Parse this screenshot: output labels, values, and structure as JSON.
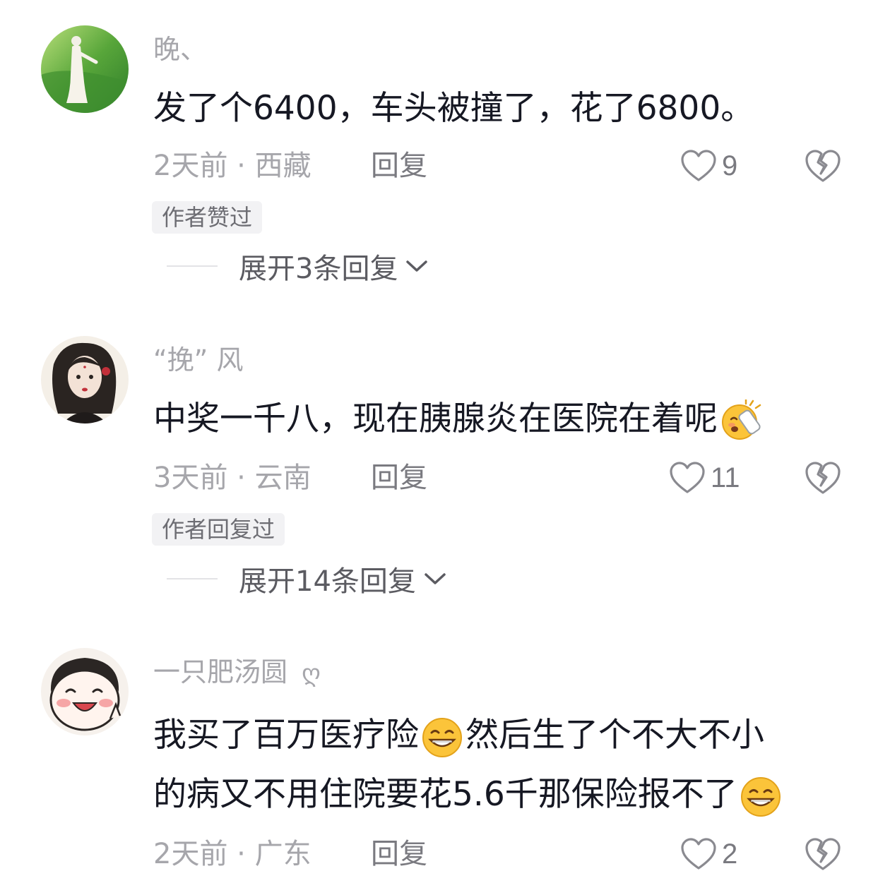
{
  "comments": [
    {
      "username": "晚、",
      "text_parts": [
        "发了个6400，车头被撞了，花了6800。"
      ],
      "meta": "2天前 · 西藏",
      "reply_label": "回复",
      "likes": "9",
      "badge": "作者赞过",
      "expand_label": "展开3条回复"
    },
    {
      "username": "“挽” 风",
      "text_parts": [
        "中奖一千八，现在胰腺炎在医院在着呢"
      ],
      "meta": "3天前 · 云南",
      "reply_label": "回复",
      "likes": "11",
      "badge": "作者回复过",
      "expand_label": "展开14条回复"
    },
    {
      "username": "一只肥汤圆",
      "username_suffix": "ღ",
      "text_line1": [
        "我买了百万医疗险",
        "然后生了个不大不小"
      ],
      "text_line2": [
        "的病又不用住院要花5.6千那保险报不了"
      ],
      "meta": "2天前 · 广东",
      "reply_label": "回复",
      "likes": "2"
    }
  ],
  "icons": {
    "like": "heart-outline-icon",
    "dislike": "broken-heart-icon",
    "expand": "chevron-down-icon",
    "emoji_grin": "grinning-emoji",
    "emoji_sick": "sick-emoji"
  },
  "colors": {
    "text": "#161823",
    "muted": "#a6a6ab",
    "badge_bg": "#f2f2f4"
  }
}
